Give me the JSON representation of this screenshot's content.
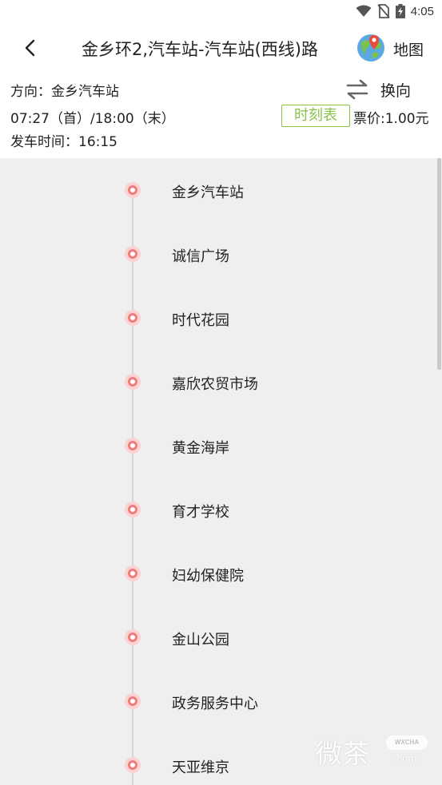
{
  "status_bar": {
    "time": "4:05"
  },
  "header": {
    "title": "金乡环2,汽车站-汽车站(西线)路",
    "map_label": "地图"
  },
  "info": {
    "direction": "方向：金乡汽车站",
    "service_hours": "07:27（首）/18:00（末）",
    "departure_time": "发车时间：16:15",
    "swap_label": "换向",
    "timetable_label": "时刻表",
    "fare": "票价:1.00元"
  },
  "stops": [
    "金乡汽车站",
    "诚信广场",
    "时代花园",
    "嘉欣农贸市场",
    "黄金海岸",
    "育才学校",
    "妇幼保健院",
    "金山公园",
    "政务服务中心",
    "天亚维京"
  ],
  "watermark": {
    "text": "微茶",
    "badge": "WXCHA",
    "domain": ".com"
  },
  "colors": {
    "accent_green": "#8bc34a",
    "stop_red": "#ef7b7b",
    "list_bg": "#efefef"
  }
}
